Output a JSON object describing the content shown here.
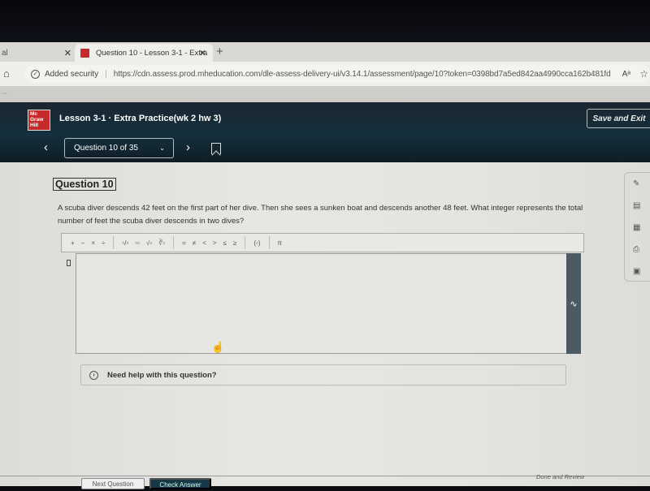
{
  "browser": {
    "prev_tab_label": "al",
    "active_tab_label": "Question 10 - Lesson 3-1 - Extra",
    "close_glyph": "✕",
    "new_tab_glyph": "+",
    "home_glyph": "⌂",
    "security_label": "Added security",
    "url": "https://cdn.assess.prod.mheducation.com/dle-assess-delivery-ui/v3.14.1/assessment/page/10?token=0398bd7a5ed842aa4990cca162b481fd",
    "read_aloud_glyph": "Aᵃ",
    "favorites_glyph": "☆",
    "strip_glyph": "···",
    "brand_color": "#c62b2b"
  },
  "header": {
    "logo_text": [
      "Mc",
      "Graw",
      "Hill"
    ],
    "lesson_title": "Lesson 3-1 · Extra Practice(wk 2 hw 3)",
    "save_exit_label": "Save and Exit",
    "prev_glyph": "‹",
    "next_glyph": "›",
    "question_selector": "Question 10 of 35",
    "chevron_glyph": "⌄"
  },
  "question": {
    "label": "Question 10",
    "text": "A scuba diver descends 42 feet on the first part of her dive. Then she sees a sunken boat and descends another 48 feet. What integer represents the total number of feet the scuba diver descends in two dives?"
  },
  "math_toolbar": {
    "groups": [
      [
        "+",
        "−",
        "×",
        "÷"
      ],
      [
        "▫/▫",
        "▫▫",
        "√▫",
        "∛▫"
      ],
      [
        "=",
        "≠",
        "<",
        ">",
        "≤",
        "≥"
      ],
      [
        "(▫)"
      ],
      [
        "π"
      ]
    ]
  },
  "answer": {
    "value": "",
    "handle_glyph": "∿",
    "cursor_glyph": "☝"
  },
  "help": {
    "icon_glyph": "›",
    "label": "Need help with this question?"
  },
  "side_tools": [
    {
      "name": "pencil-icon",
      "glyph": "✎"
    },
    {
      "name": "notepad-icon",
      "glyph": "▤"
    },
    {
      "name": "calculator-icon",
      "glyph": "▦"
    },
    {
      "name": "print-icon",
      "glyph": "⎙"
    },
    {
      "name": "reference-icon",
      "glyph": "▣"
    }
  ],
  "footer": {
    "next_question_label": "Next Question",
    "check_answer_label": "Check Answer",
    "done_review_label": "Done and Review"
  }
}
